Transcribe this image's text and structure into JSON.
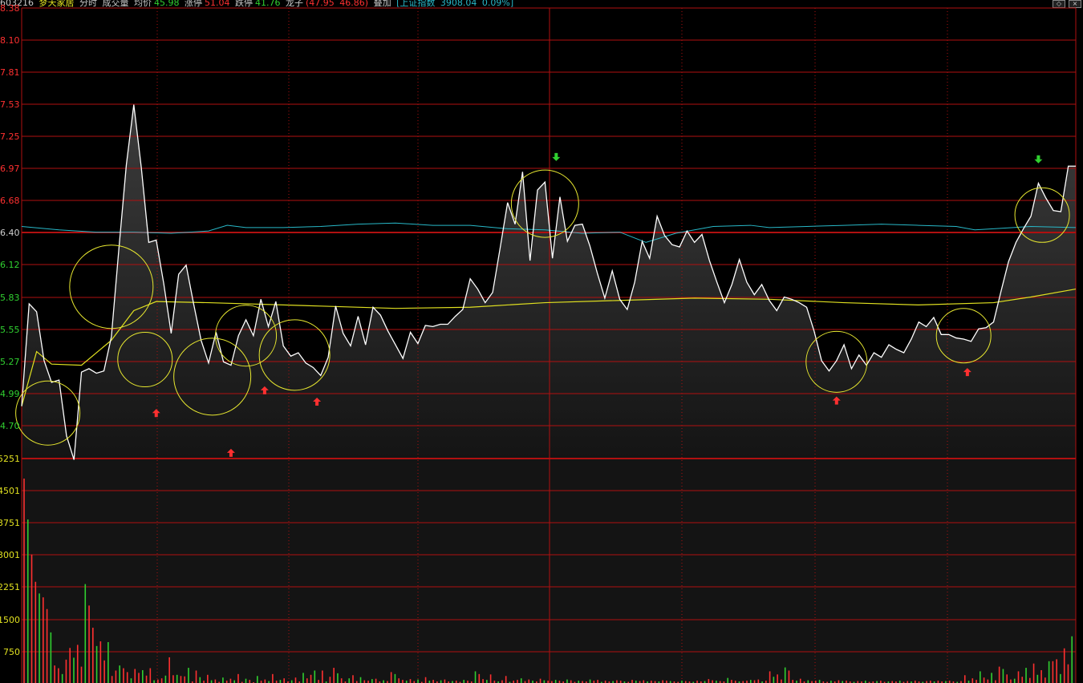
{
  "header": {
    "code": "603216",
    "name": "梦天家居",
    "mode": "分时",
    "indicator": "成交量",
    "avg_label": "均价",
    "avg_value": "45.98",
    "up_limit_label": "涨停",
    "up_limit_value": "51.04",
    "down_limit_label": "跌停",
    "down_limit_value": "41.76",
    "leader_label": "龙子",
    "leader_value": "(47.95",
    "leader_value2": "46.86)",
    "index_label": "叠加",
    "index_name": "[上证指数",
    "index_value": "3908.04",
    "index_pct": "0.09%]"
  },
  "colors": {
    "bg": "#000000",
    "grid": "#b01010",
    "price_line": "#ffffff",
    "avg_line": "#e0e020",
    "index_line": "#28b8c8",
    "up": "#ff3030",
    "down": "#30d030",
    "annotation_circle": "#e8e830"
  },
  "chart_data": {
    "type": "line",
    "price_axis_labels": [
      "8.38",
      "8.10",
      "7.81",
      "7.53",
      "7.25",
      "6.97",
      "6.68",
      "6.40",
      "6.12",
      "5.83",
      "5.55",
      "5.27",
      "4.99",
      "4.70"
    ],
    "volume_axis_labels": [
      "5251",
      "4501",
      "3751",
      "3001",
      "2251",
      "1500",
      "750"
    ],
    "ylim": [
      4.42,
      8.38
    ],
    "price_series": [
      [
        0,
        4.88
      ],
      [
        2,
        5.78
      ],
      [
        4,
        5.71
      ],
      [
        6,
        5.28
      ],
      [
        8,
        5.09
      ],
      [
        10,
        5.11
      ],
      [
        12,
        4.62
      ],
      [
        14,
        4.41
      ],
      [
        16,
        5.18
      ],
      [
        18,
        5.21
      ],
      [
        20,
        5.17
      ],
      [
        22,
        5.19
      ],
      [
        24,
        5.49
      ],
      [
        26,
        6.26
      ],
      [
        28,
        7.0
      ],
      [
        30,
        7.53
      ],
      [
        32,
        6.98
      ],
      [
        34,
        6.32
      ],
      [
        36,
        6.34
      ],
      [
        38,
        5.96
      ],
      [
        40,
        5.52
      ],
      [
        42,
        6.04
      ],
      [
        44,
        6.12
      ],
      [
        46,
        5.78
      ],
      [
        48,
        5.46
      ],
      [
        50,
        5.26
      ],
      [
        52,
        5.53
      ],
      [
        54,
        5.27
      ],
      [
        56,
        5.24
      ],
      [
        58,
        5.5
      ],
      [
        60,
        5.64
      ],
      [
        62,
        5.5
      ],
      [
        64,
        5.82
      ],
      [
        66,
        5.58
      ],
      [
        68,
        5.8
      ],
      [
        70,
        5.41
      ],
      [
        72,
        5.32
      ],
      [
        74,
        5.35
      ],
      [
        76,
        5.26
      ],
      [
        78,
        5.22
      ],
      [
        80,
        5.15
      ],
      [
        82,
        5.31
      ],
      [
        84,
        5.76
      ],
      [
        86,
        5.52
      ],
      [
        88,
        5.41
      ],
      [
        90,
        5.67
      ],
      [
        92,
        5.42
      ],
      [
        94,
        5.75
      ],
      [
        96,
        5.68
      ],
      [
        98,
        5.54
      ],
      [
        100,
        5.42
      ],
      [
        102,
        5.3
      ],
      [
        104,
        5.53
      ],
      [
        106,
        5.43
      ],
      [
        108,
        5.59
      ],
      [
        110,
        5.58
      ],
      [
        112,
        5.6
      ],
      [
        114,
        5.6
      ],
      [
        116,
        5.67
      ],
      [
        118,
        5.73
      ],
      [
        120,
        6.0
      ],
      [
        122,
        5.91
      ],
      [
        124,
        5.79
      ],
      [
        126,
        5.88
      ],
      [
        128,
        6.27
      ],
      [
        130,
        6.67
      ],
      [
        132,
        6.48
      ],
      [
        134,
        6.94
      ],
      [
        136,
        6.16
      ],
      [
        138,
        6.78
      ],
      [
        140,
        6.85
      ],
      [
        142,
        6.18
      ],
      [
        144,
        6.72
      ],
      [
        146,
        6.33
      ],
      [
        148,
        6.47
      ],
      [
        150,
        6.48
      ],
      [
        152,
        6.29
      ],
      [
        154,
        6.05
      ],
      [
        156,
        5.83
      ],
      [
        158,
        6.07
      ],
      [
        160,
        5.82
      ],
      [
        162,
        5.73
      ],
      [
        164,
        5.97
      ],
      [
        166,
        6.33
      ],
      [
        168,
        6.18
      ],
      [
        170,
        6.55
      ],
      [
        172,
        6.38
      ],
      [
        174,
        6.3
      ],
      [
        176,
        6.28
      ],
      [
        178,
        6.42
      ],
      [
        180,
        6.32
      ],
      [
        182,
        6.39
      ],
      [
        184,
        6.16
      ],
      [
        186,
        5.97
      ],
      [
        188,
        5.79
      ],
      [
        190,
        5.95
      ],
      [
        192,
        6.17
      ],
      [
        194,
        5.97
      ],
      [
        196,
        5.86
      ],
      [
        198,
        5.95
      ],
      [
        200,
        5.81
      ],
      [
        202,
        5.72
      ],
      [
        204,
        5.84
      ],
      [
        206,
        5.82
      ],
      [
        208,
        5.79
      ],
      [
        210,
        5.75
      ],
      [
        212,
        5.54
      ],
      [
        214,
        5.28
      ],
      [
        216,
        5.19
      ],
      [
        218,
        5.28
      ],
      [
        220,
        5.42
      ],
      [
        222,
        5.21
      ],
      [
        224,
        5.33
      ],
      [
        226,
        5.24
      ],
      [
        228,
        5.35
      ],
      [
        230,
        5.31
      ],
      [
        232,
        5.42
      ],
      [
        234,
        5.38
      ],
      [
        236,
        5.35
      ],
      [
        238,
        5.47
      ],
      [
        240,
        5.62
      ],
      [
        242,
        5.58
      ],
      [
        244,
        5.66
      ],
      [
        246,
        5.51
      ],
      [
        248,
        5.51
      ],
      [
        250,
        5.48
      ],
      [
        252,
        5.47
      ],
      [
        254,
        5.45
      ],
      [
        256,
        5.56
      ],
      [
        258,
        5.57
      ],
      [
        260,
        5.62
      ],
      [
        262,
        5.89
      ],
      [
        264,
        6.15
      ],
      [
        266,
        6.32
      ],
      [
        268,
        6.44
      ],
      [
        270,
        6.55
      ],
      [
        272,
        6.84
      ],
      [
        274,
        6.71
      ],
      [
        276,
        6.6
      ],
      [
        278,
        6.59
      ],
      [
        280,
        6.99
      ],
      [
        282,
        6.99
      ]
    ],
    "avg_series": [
      [
        0,
        4.88
      ],
      [
        4,
        5.36
      ],
      [
        8,
        5.25
      ],
      [
        16,
        5.24
      ],
      [
        24,
        5.46
      ],
      [
        30,
        5.72
      ],
      [
        36,
        5.8
      ],
      [
        50,
        5.79
      ],
      [
        80,
        5.76
      ],
      [
        100,
        5.74
      ],
      [
        120,
        5.75
      ],
      [
        140,
        5.79
      ],
      [
        160,
        5.81
      ],
      [
        180,
        5.83
      ],
      [
        200,
        5.82
      ],
      [
        220,
        5.79
      ],
      [
        240,
        5.77
      ],
      [
        260,
        5.79
      ],
      [
        270,
        5.84
      ],
      [
        282,
        5.91
      ]
    ],
    "index_series": [
      [
        0,
        6.46
      ],
      [
        10,
        6.43
      ],
      [
        20,
        6.41
      ],
      [
        30,
        6.41
      ],
      [
        40,
        6.4
      ],
      [
        50,
        6.42
      ],
      [
        55,
        6.47
      ],
      [
        60,
        6.45
      ],
      [
        70,
        6.45
      ],
      [
        80,
        6.46
      ],
      [
        90,
        6.48
      ],
      [
        100,
        6.49
      ],
      [
        110,
        6.47
      ],
      [
        120,
        6.47
      ],
      [
        130,
        6.44
      ],
      [
        140,
        6.43
      ],
      [
        150,
        6.4
      ],
      [
        160,
        6.41
      ],
      [
        167,
        6.32
      ],
      [
        175,
        6.4
      ],
      [
        185,
        6.46
      ],
      [
        195,
        6.47
      ],
      [
        200,
        6.45
      ],
      [
        210,
        6.46
      ],
      [
        220,
        6.47
      ],
      [
        230,
        6.48
      ],
      [
        240,
        6.47
      ],
      [
        250,
        6.46
      ],
      [
        255,
        6.43
      ],
      [
        260,
        6.44
      ],
      [
        270,
        6.46
      ],
      [
        282,
        6.45
      ]
    ],
    "volume": [
      5251,
      4200,
      3300,
      2600,
      2300,
      2200,
      1900,
      1300,
      450,
      380,
      230,
      600,
      900,
      650,
      980,
      420,
      2540,
      1990,
      1420,
      950,
      1070,
      580,
      1050,
      180,
      320,
      450,
      380,
      280,
      120,
      360,
      260,
      330,
      190,
      380,
      70,
      90,
      120,
      190,
      660,
      200,
      210,
      180,
      170,
      390,
      40,
      320,
      150,
      60,
      210,
      70,
      90,
      30,
      140,
      60,
      110,
      70,
      230,
      30,
      110,
      80,
      20,
      180,
      60,
      90,
      50,
      230,
      60,
      80,
      120,
      40,
      70,
      140,
      40,
      260,
      120,
      210,
      320,
      80,
      320,
      40,
      160,
      390,
      250,
      120,
      40,
      120,
      200,
      50,
      150,
      70,
      60,
      100,
      110,
      40,
      70,
      50,
      280,
      230,
      120,
      80,
      60,
      100,
      50,
      90,
      30,
      150,
      60,
      80,
      40,
      70,
      90,
      40,
      50,
      60,
      30,
      80,
      60,
      40,
      300,
      230,
      100,
      80,
      220,
      60,
      40,
      70,
      180,
      30,
      60,
      80,
      120,
      50,
      90,
      60,
      40,
      110,
      70,
      60,
      50,
      80,
      60,
      40,
      90,
      70,
      30,
      60,
      50,
      40,
      90,
      60,
      80,
      30,
      60,
      40,
      50,
      70,
      60,
      40,
      30,
      80,
      60,
      50,
      70,
      40,
      60,
      50,
      40,
      70,
      60,
      50,
      40,
      30,
      60,
      50,
      40,
      30,
      60,
      40,
      50,
      100,
      70,
      60,
      50,
      40,
      130,
      80,
      60,
      40,
      50,
      60,
      80,
      70,
      90,
      40,
      60,
      300,
      160,
      220,
      90,
      400,
      320,
      80,
      60,
      110,
      40,
      70,
      50,
      60,
      80,
      40,
      30,
      60,
      40,
      70,
      50,
      60,
      40,
      30,
      50,
      40,
      60,
      30,
      40,
      50,
      60,
      30,
      40,
      50,
      40,
      60,
      30,
      50,
      40,
      60,
      40,
      30,
      50,
      60,
      40,
      60,
      40,
      50,
      60,
      40,
      30,
      50,
      200,
      60,
      120,
      80,
      300,
      140,
      90,
      260,
      70,
      420,
      360,
      220,
      90,
      110,
      300,
      160,
      390,
      130,
      500,
      210,
      330,
      140,
      560,
      560,
      610,
      230,
      890,
      480,
      1200
    ],
    "circles": [
      {
        "t": 7,
        "p": 4.82,
        "r": 40,
        "s": 1
      },
      {
        "t": 24,
        "p": 5.93,
        "r": 52,
        "s": 0
      },
      {
        "t": 33,
        "p": 5.29,
        "r": 34,
        "s": 0
      },
      {
        "t": 51,
        "p": 5.14,
        "r": 48,
        "s": 0
      },
      {
        "t": 60,
        "p": 5.5,
        "r": 38,
        "s": 0
      },
      {
        "t": 73,
        "p": 5.33,
        "r": 44,
        "s": 0
      },
      {
        "t": 140,
        "p": 6.66,
        "r": 42,
        "s": 0
      },
      {
        "t": 218,
        "p": 5.27,
        "r": 38,
        "s": 0
      },
      {
        "t": 252,
        "p": 5.5,
        "r": 34,
        "s": 0
      },
      {
        "t": 273,
        "p": 6.56,
        "r": 34,
        "s": 0
      }
    ],
    "arrows": [
      {
        "t": 36,
        "p": 4.82,
        "dir": "up"
      },
      {
        "t": 56,
        "p": 4.47,
        "dir": "up"
      },
      {
        "t": 65,
        "p": 5.02,
        "dir": "up"
      },
      {
        "t": 79,
        "p": 4.92,
        "dir": "up"
      },
      {
        "t": 143,
        "p": 7.07,
        "dir": "down"
      },
      {
        "t": 218,
        "p": 4.93,
        "dir": "up"
      },
      {
        "t": 253,
        "p": 5.18,
        "dir": "up"
      },
      {
        "t": 272,
        "p": 7.05,
        "dir": "down"
      }
    ]
  }
}
